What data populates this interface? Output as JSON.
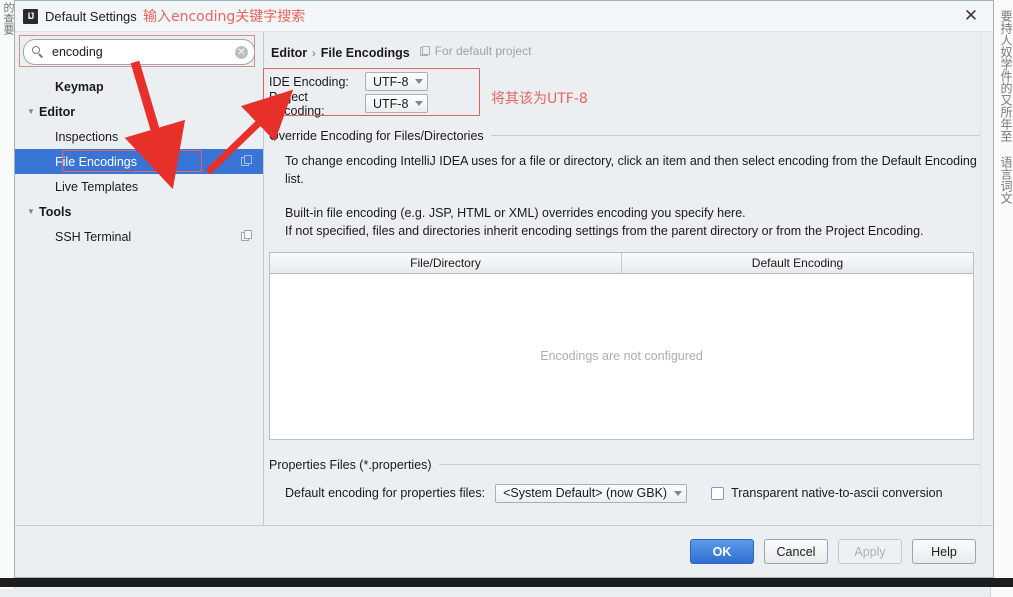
{
  "background": {
    "left_strip_text": "的查要",
    "right_strip_text": "要持人奴学件的又所年至 语言词文"
  },
  "dialog": {
    "title": "Default Settings",
    "app_icon": "intellij-idea-icon",
    "close_icon": "close-icon"
  },
  "search": {
    "value": "encoding",
    "placeholder": "Search settings",
    "icon": "search-icon",
    "clear_icon": "clear-icon",
    "clear_glyph": "✕"
  },
  "sidebar": {
    "items": [
      {
        "label": "Keymap",
        "type": "group",
        "twisty": "",
        "indent": "indent2",
        "selected": false,
        "has_icon": false
      },
      {
        "label": "Editor",
        "type": "group",
        "twisty": "▼",
        "indent": "",
        "selected": false,
        "has_icon": false
      },
      {
        "label": "Inspections",
        "type": "leaf",
        "twisty": "",
        "indent": "indent",
        "selected": false,
        "has_icon": false
      },
      {
        "label": "File Encodings",
        "type": "leaf",
        "twisty": "",
        "indent": "indent",
        "selected": true,
        "has_icon": true
      },
      {
        "label": "Live Templates",
        "type": "leaf",
        "twisty": "",
        "indent": "indent",
        "selected": false,
        "has_icon": false
      },
      {
        "label": "Tools",
        "type": "group",
        "twisty": "▼",
        "indent": "",
        "selected": false,
        "has_icon": false
      },
      {
        "label": "SSH Terminal",
        "type": "leaf",
        "twisty": "",
        "indent": "indent",
        "selected": false,
        "has_icon": true
      }
    ]
  },
  "content": {
    "breadcrumb": {
      "parent": "Editor",
      "separator": "›",
      "current": "File Encodings",
      "hint": "For default project",
      "hint_icon": "copy-icon"
    },
    "encoding": {
      "ide_label": "IDE Encoding:",
      "ide_value": "UTF-8",
      "project_label": "Project Encoding:",
      "project_value": "UTF-8",
      "arrow_icon": "chevron-down-icon"
    },
    "override_section": {
      "title": "Override Encoding for Files/Directories",
      "paragraph_1": "To change encoding IntelliJ IDEA uses for a file or directory, click an item and then select encoding from the Default Encoding list.",
      "paragraph_2": "Built-in file encoding (e.g. JSP, HTML or XML) overrides encoding you specify here.",
      "paragraph_3": "If not specified, files and directories inherit encoding settings from the parent directory or from the Project Encoding."
    },
    "table": {
      "columns": [
        "File/Directory",
        "Default Encoding"
      ],
      "rows": [],
      "empty_text": "Encodings are not configured"
    },
    "properties_section": {
      "title": "Properties Files (*.properties)",
      "default_encoding_label": "Default encoding for properties files:",
      "default_encoding_value": "<System Default> (now GBK)",
      "checkbox_label": "Transparent native-to-ascii conversion",
      "checkbox_checked": false
    }
  },
  "footer": {
    "buttons": [
      {
        "label": "OK",
        "style": "primary",
        "enabled": true
      },
      {
        "label": "Cancel",
        "style": "normal",
        "enabled": true
      },
      {
        "label": "Apply",
        "style": "disabled",
        "enabled": false
      },
      {
        "label": "Help",
        "style": "normal",
        "enabled": true
      }
    ]
  },
  "annotations": {
    "accent_color": "#e8645f",
    "top_note": "输入encoding关键字搜索",
    "encoding_note": "将其该为UTF-8"
  }
}
